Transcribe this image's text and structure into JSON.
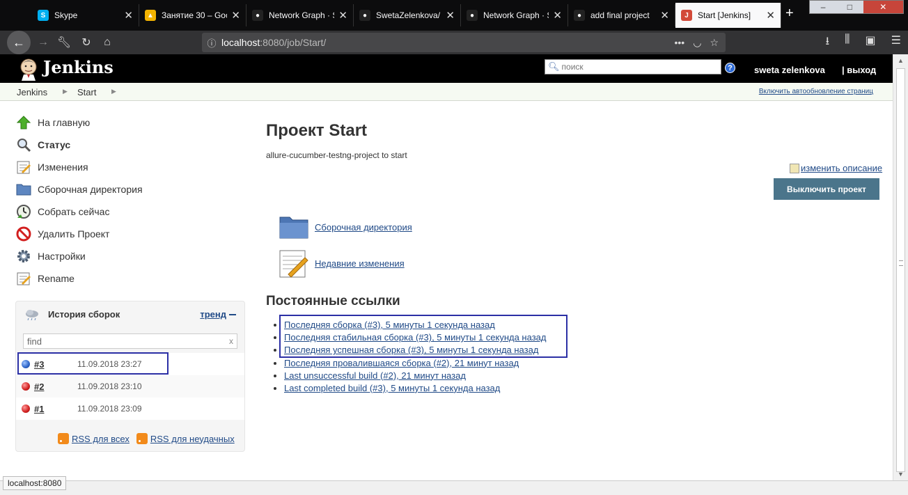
{
  "browser": {
    "tabs": [
      {
        "label": "Skype",
        "icon": "skype-icon",
        "color": "#00aff0",
        "glyph": "S"
      },
      {
        "label": "Занятие 30 – Goo",
        "icon": "google-drive-icon",
        "color": "#f4b400",
        "glyph": "▲"
      },
      {
        "label": "Network Graph · S",
        "icon": "github-icon",
        "color": "#222222",
        "glyph": "●"
      },
      {
        "label": "SwetaZelenkova/",
        "icon": "github-icon",
        "color": "#222222",
        "glyph": "●"
      },
      {
        "label": "Network Graph · S",
        "icon": "github-icon",
        "color": "#222222",
        "glyph": "●"
      },
      {
        "label": "add final project",
        "icon": "github-icon",
        "color": "#222222",
        "glyph": "●"
      },
      {
        "label": "Start [Jenkins]",
        "icon": "jenkins-icon",
        "color": "#d24939",
        "glyph": "J"
      }
    ],
    "url_host": "localhost",
    "url_rest": ":8080/job/Start/",
    "status_tip": "localhost:8080"
  },
  "header": {
    "title": "Jenkins",
    "search_placeholder": "поиск",
    "user": "sweta zelenkova",
    "logout": "| выход"
  },
  "breadcrumb": {
    "items": [
      "Jenkins",
      "Start"
    ],
    "autorefresh": "Включить автообновление страниц"
  },
  "sidebar": {
    "items": [
      {
        "label": "На главную",
        "icon": "up-arrow-icon"
      },
      {
        "label": "Статус",
        "icon": "magnifier-icon"
      },
      {
        "label": "Изменения",
        "icon": "notepad-icon"
      },
      {
        "label": "Сборочная директория",
        "icon": "folder-icon"
      },
      {
        "label": "Собрать сейчас",
        "icon": "clock-icon"
      },
      {
        "label": "Удалить Проект",
        "icon": "no-entry-icon"
      },
      {
        "label": "Настройки",
        "icon": "gear-icon"
      },
      {
        "label": "Rename",
        "icon": "notepad-icon"
      }
    ]
  },
  "history": {
    "title": "История сборок",
    "trend": "тренд",
    "filter_value": "find",
    "clear": "x",
    "builds": [
      {
        "num": "#3",
        "date": "11.09.2018 23:27",
        "status": "blue"
      },
      {
        "num": "#2",
        "date": "11.09.2018 23:10",
        "status": "red"
      },
      {
        "num": "#1",
        "date": "11.09.2018 23:09",
        "status": "red"
      }
    ],
    "rss_all": "RSS для всех",
    "rss_failed": "RSS для неудачных"
  },
  "main": {
    "title": "Проект Start",
    "description": "allure-cucumber-testng-project to start",
    "edit_description": "изменить описание",
    "disable_button": "Выключить проект",
    "links": [
      {
        "label": "Сборочная директория",
        "icon": "folder-icon"
      },
      {
        "label": "Недавние изменения",
        "icon": "notepad-icon"
      }
    ],
    "permalinks_title": "Постоянные ссылки",
    "permalinks": [
      "Последняя сборка (#3), 5 минуты 1 секунда назад",
      "Последняя стабильная сборка (#3), 5 минуты 1 секунда назад",
      "Последняя успешная сборка (#3), 5 минуты 1 секунда назад",
      "Последняя провалившаяся сборка (#2), 21 минут назад",
      "Last unsuccessful build (#2), 21 минут назад",
      "Last completed build (#3), 5 минуты 1 секунда назад"
    ]
  }
}
